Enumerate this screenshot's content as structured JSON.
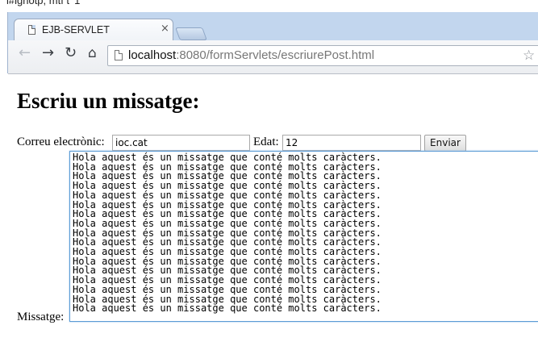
{
  "browser": {
    "top_cut_text": "l#ignotp, mtf t' 1",
    "tab": {
      "title": "EJB-SERVLET",
      "close": "×"
    },
    "url": {
      "host": "localhost",
      "rest": ":8080/formServlets/escriurePost.html"
    },
    "icons": [
      "page-icon",
      "back-arrow-icon",
      "forward-arrow-icon",
      "reload-icon",
      "home-icon",
      "star-icon",
      "close-icon"
    ]
  },
  "page": {
    "title": "Escriu un missatge:",
    "form": {
      "email_label": "Correu electrònic:",
      "email_value": "ioc.cat",
      "age_label": "Edat:",
      "age_value": "12",
      "submit_label": "Enviar",
      "message_label": "Missatge:",
      "message_lines": [
        "Hola aquest és un missatge que conté molts caràcters.",
        "Hola aquest és un missatge que conté molts caràcters.",
        "Hola aquest és un missatge que conté molts caràcters.",
        "Hola aquest és un missatge que conté molts caràcters.",
        "Hola aquest és un missatge que conté molts caràcters.",
        "Hola aquest és un missatge que conté molts caràcters.",
        "Hola aquest és un missatge que conté molts caràcters.",
        "Hola aquest és un missatge que conté molts caràcters.",
        "Hola aquest és un missatge que conté molts caràcters.",
        "Hola aquest és un missatge que conté molts caràcters.",
        "Hola aquest és un missatge que conté molts caràcters.",
        "Hola aquest és un missatge que conté molts caràcters.",
        "Hola aquest és un missatge que conté molts caràcters.",
        "Hola aquest és un missatge que conté molts caràcters.",
        "Hola aquest és un missatge que conté molts caràcters.",
        "Hola aquest és un missatge que conté molts caràcters.",
        "Hola aquest és un missatge que conté molts caràcters."
      ]
    }
  }
}
